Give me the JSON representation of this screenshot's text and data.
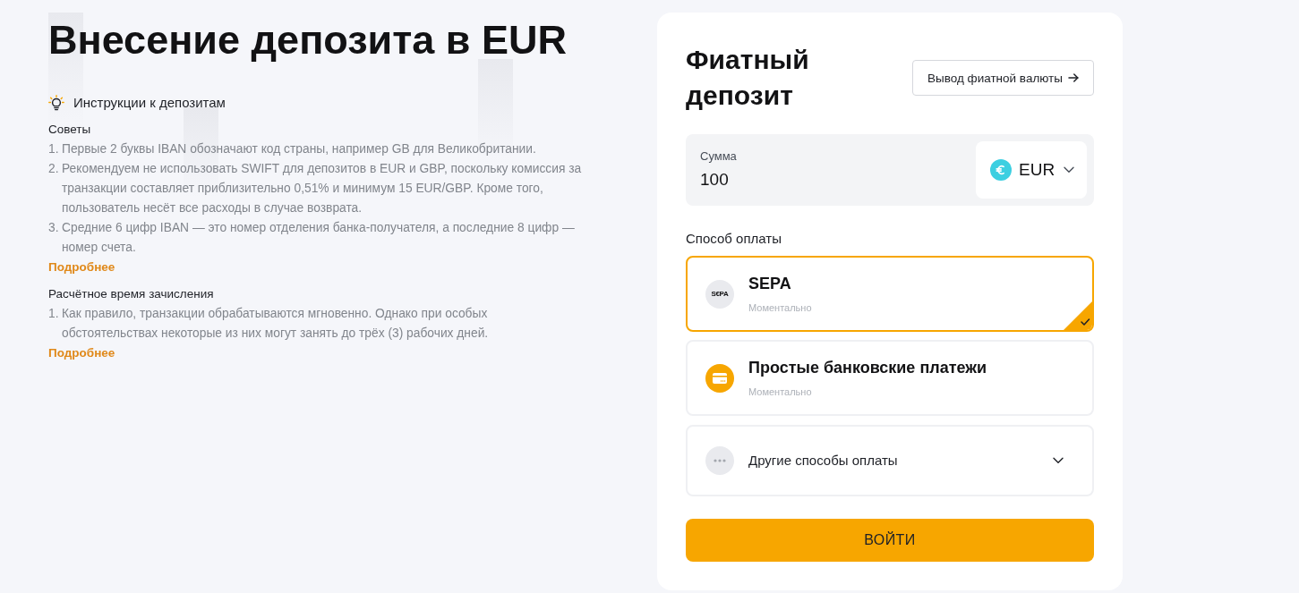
{
  "page_title": "Внесение депозита в EUR",
  "instructions": {
    "heading": "Инструкции к депозитам",
    "sections": [
      {
        "title": "Советы",
        "items": [
          {
            "number": "1.",
            "text": "Первые 2 буквы IBAN обозначают код страны, например GB для Великобритании."
          },
          {
            "number": "2.",
            "text": "Рекомендуем не использовать SWIFT для депозитов в EUR и GBP, поскольку комиссия за транзакции составляет приблизительно 0,51% и минимум 15 EUR/GBP. Кроме того, пользователь несёт все расходы в случае возврата."
          },
          {
            "number": "3.",
            "text": "Средние 6 цифр IBAN — это номер отделения банка-получателя, а последние 8 цифр — номер счета."
          }
        ],
        "link": "Подробнее"
      },
      {
        "title": "Расчётное время зачисления",
        "items": [
          {
            "number": "1.",
            "text": "Как правило, транзакции обрабатываются мгновенно. Однако при особых обстоятельствах некоторые из них могут занять до трёх (3) рабочих дней."
          }
        ],
        "link": "Подробнее"
      }
    ]
  },
  "deposit_card": {
    "title": "Фиатный депозит",
    "withdraw_button": "Вывод фиатной валюты",
    "amount": {
      "label": "Сумма",
      "value": "100"
    },
    "currency": {
      "code": "EUR"
    },
    "payment_label": "Способ оплаты",
    "payment_methods": [
      {
        "kind": "sepa",
        "logo": "S€PA",
        "name": "SEPA",
        "note": "Моментально",
        "selected": true
      },
      {
        "kind": "bank",
        "name": "Простые банковские платежи",
        "note": "Моментально",
        "selected": false
      },
      {
        "kind": "more",
        "name": "Другие способы оплаты",
        "expanded": false,
        "selected": false
      }
    ],
    "submit_button": "ВОЙТИ"
  }
}
